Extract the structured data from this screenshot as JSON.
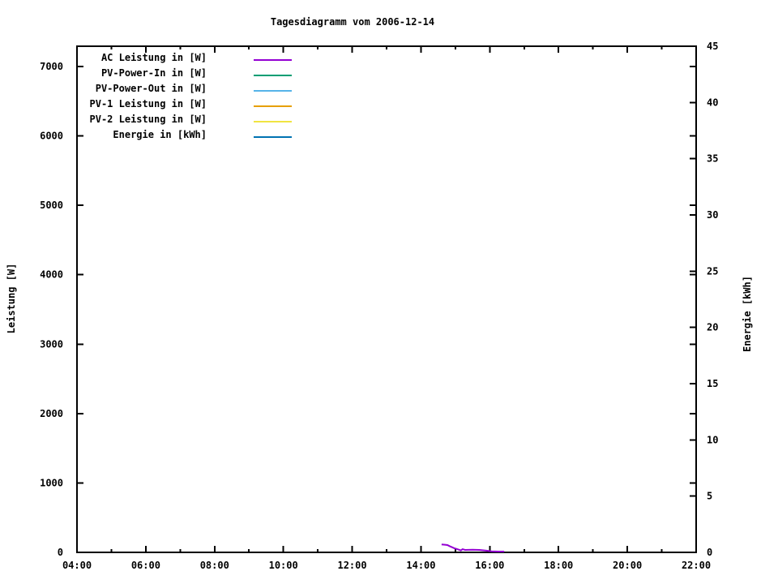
{
  "colors": {
    "background": "#ffffff",
    "foreground": "#000000"
  },
  "chart_data": {
    "type": "line",
    "title": "Tagesdiagramm vom 2006-12-14",
    "grid": false,
    "legend_position": "top-left-inside",
    "x_axis": {
      "label": "",
      "unit": "time of day",
      "range_hours": [
        4,
        22
      ],
      "major_step_hours": 2,
      "minor_step_hours": 1,
      "major_tick_labels": [
        "04:00",
        "06:00",
        "08:00",
        "10:00",
        "12:00",
        "14:00",
        "16:00",
        "18:00",
        "20:00",
        "22:00"
      ]
    },
    "y_axis": {
      "label": "Leistung [W]",
      "range": [
        0,
        7292
      ],
      "ticks": [
        0,
        1000,
        2000,
        3000,
        4000,
        5000,
        6000,
        7000
      ]
    },
    "y2_axis": {
      "label": "Energie [kWh]",
      "range": [
        0,
        45
      ],
      "ticks": [
        0,
        5,
        10,
        15,
        20,
        25,
        30,
        35,
        40,
        45
      ]
    },
    "series": [
      {
        "name": "AC Leistung in [W]",
        "color": "#9400d3",
        "axis": "y1",
        "points": [
          [
            14.6,
            115
          ],
          [
            14.7,
            110
          ],
          [
            14.77,
            105
          ],
          [
            14.83,
            90
          ],
          [
            14.9,
            75
          ],
          [
            14.97,
            60
          ],
          [
            15.03,
            50
          ],
          [
            15.1,
            38
          ],
          [
            15.16,
            28
          ],
          [
            15.21,
            45
          ],
          [
            15.28,
            35
          ],
          [
            15.5,
            38
          ],
          [
            15.7,
            35
          ],
          [
            15.9,
            25
          ],
          [
            16.05,
            15
          ],
          [
            16.25,
            12
          ],
          [
            16.42,
            12
          ]
        ]
      },
      {
        "name": "PV-Power-In in [W]",
        "color": "#009e73",
        "axis": "y1",
        "points": []
      },
      {
        "name": "PV-Power-Out in [W]",
        "color": "#56b4e9",
        "axis": "y1",
        "points": []
      },
      {
        "name": "PV-1 Leistung in [W]",
        "color": "#e69f00",
        "axis": "y1",
        "points": []
      },
      {
        "name": "PV-2 Leistung in [W]",
        "color": "#f0e442",
        "axis": "y1",
        "points": []
      },
      {
        "name": "Energie in [kWh]",
        "color": "#0072b2",
        "axis": "y2",
        "points": []
      }
    ]
  }
}
